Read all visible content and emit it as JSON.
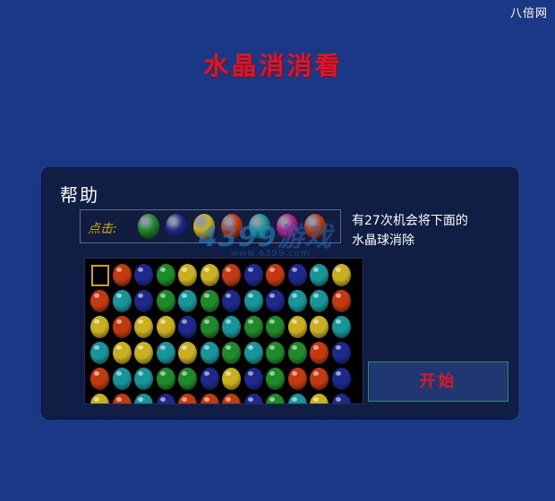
{
  "brand": "八倍网",
  "game_title": "水晶消消看",
  "help": {
    "title": "帮助",
    "click_label": "点击:",
    "click_gem_colors": [
      "green",
      "blue",
      "yellow",
      "red",
      "teal",
      "magenta",
      "red"
    ],
    "text_line1": "有27次机会将下面的",
    "text_line2": "水晶球消除"
  },
  "start_label": "开始",
  "watermark": {
    "digits": "4399",
    "word": "游戏",
    "sub": "www.4399.com"
  },
  "gem_palette": {
    "red": "#c23a10",
    "blue": "#1d2a8c",
    "green": "#1f8a2a",
    "yellow": "#c9b020",
    "teal": "#17959a",
    "magenta": "#b0208c"
  },
  "board": {
    "cursor_cell": [
      0,
      0
    ],
    "rows": [
      [
        "empty",
        "red",
        "blue",
        "green",
        "yellow",
        "yellow",
        "red",
        "blue",
        "red",
        "blue",
        "teal",
        "yellow"
      ],
      [
        "red",
        "teal",
        "blue",
        "green",
        "teal",
        "green",
        "blue",
        "teal",
        "blue",
        "teal",
        "teal",
        "red"
      ],
      [
        "yellow",
        "red",
        "yellow",
        "yellow",
        "blue",
        "green",
        "teal",
        "green",
        "green",
        "yellow",
        "yellow",
        "teal"
      ],
      [
        "teal",
        "yellow",
        "yellow",
        "teal",
        "yellow",
        "teal",
        "green",
        "teal",
        "green",
        "green",
        "red",
        "blue"
      ],
      [
        "red",
        "teal",
        "teal",
        "green",
        "green",
        "blue",
        "yellow",
        "blue",
        "green",
        "red",
        "red",
        "blue"
      ],
      [
        "yellow",
        "red",
        "teal",
        "blue",
        "red",
        "red",
        "red",
        "blue",
        "green",
        "teal",
        "yellow",
        "blue"
      ]
    ]
  }
}
